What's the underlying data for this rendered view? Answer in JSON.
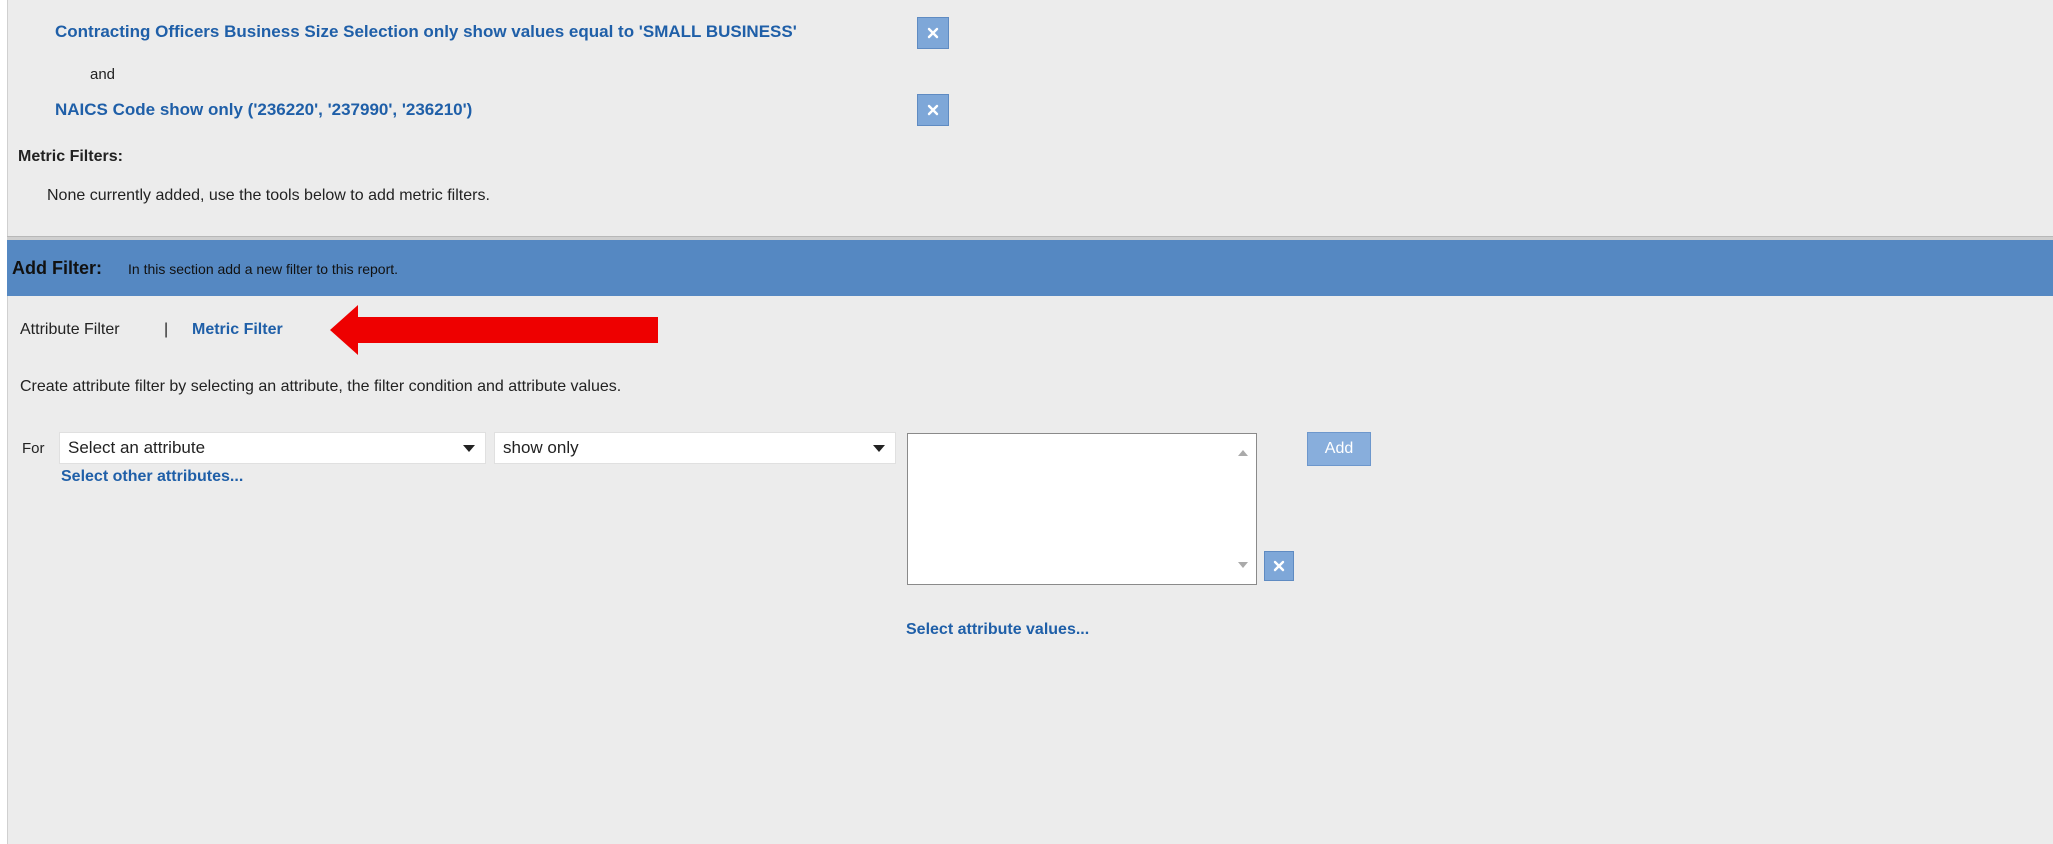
{
  "attribute_filters": [
    {
      "text": "Contracting Officers Business Size Selection only show values equal to 'SMALL BUSINESS'"
    },
    {
      "text": "NAICS Code show only ('236220', '237990', '236210')"
    }
  ],
  "conjunction": "and",
  "metric_filters": {
    "heading": "Metric Filters:",
    "empty_text": "None currently added, use the tools below to add metric filters."
  },
  "add_filter": {
    "title": "Add Filter:",
    "description": "In this section add a new filter to this report.",
    "tabs": [
      {
        "label": "Attribute Filter",
        "active": true
      },
      {
        "label": "Metric Filter",
        "active": false
      }
    ],
    "separator": "|",
    "instructions": "Create attribute filter by selecting an attribute, the filter condition and attribute values.",
    "for_label": "For",
    "attribute_select": {
      "value": "Select an attribute"
    },
    "condition_select": {
      "value": "show only"
    },
    "select_other_link": "Select other attributes...",
    "select_values_link": "Select attribute values...",
    "add_button": "Add"
  },
  "colors": {
    "link": "#1f5fa8",
    "header_bar": "#5588c2",
    "button": "#7ea7d8",
    "annotation_arrow": "#ee0000"
  }
}
